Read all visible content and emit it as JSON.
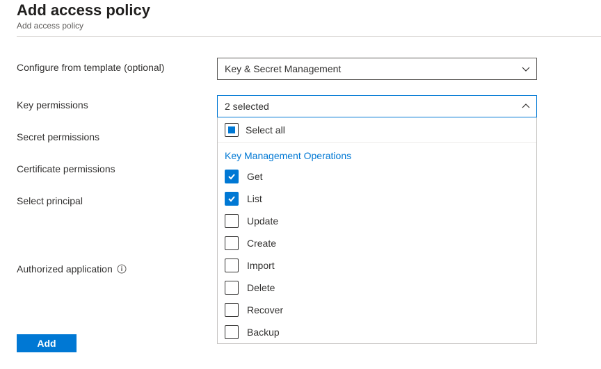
{
  "header": {
    "title": "Add access policy",
    "breadcrumb": "Add access policy"
  },
  "form": {
    "configure_label": "Configure from template (optional)",
    "key_perms_label": "Key permissions",
    "secret_perms_label": "Secret permissions",
    "cert_perms_label": "Certificate permissions",
    "select_principal_label": "Select principal",
    "authorized_app_label": "Authorized application"
  },
  "selects": {
    "template": {
      "selected": "Key & Secret Management"
    },
    "key_permissions": {
      "summary": "2 selected",
      "select_all_label": "Select all",
      "group_header": "Key Management Operations",
      "options": [
        {
          "label": "Get",
          "checked": true
        },
        {
          "label": "List",
          "checked": true
        },
        {
          "label": "Update",
          "checked": false
        },
        {
          "label": "Create",
          "checked": false
        },
        {
          "label": "Import",
          "checked": false
        },
        {
          "label": "Delete",
          "checked": false
        },
        {
          "label": "Recover",
          "checked": false
        },
        {
          "label": "Backup",
          "checked": false
        }
      ]
    }
  },
  "buttons": {
    "add": "Add"
  }
}
